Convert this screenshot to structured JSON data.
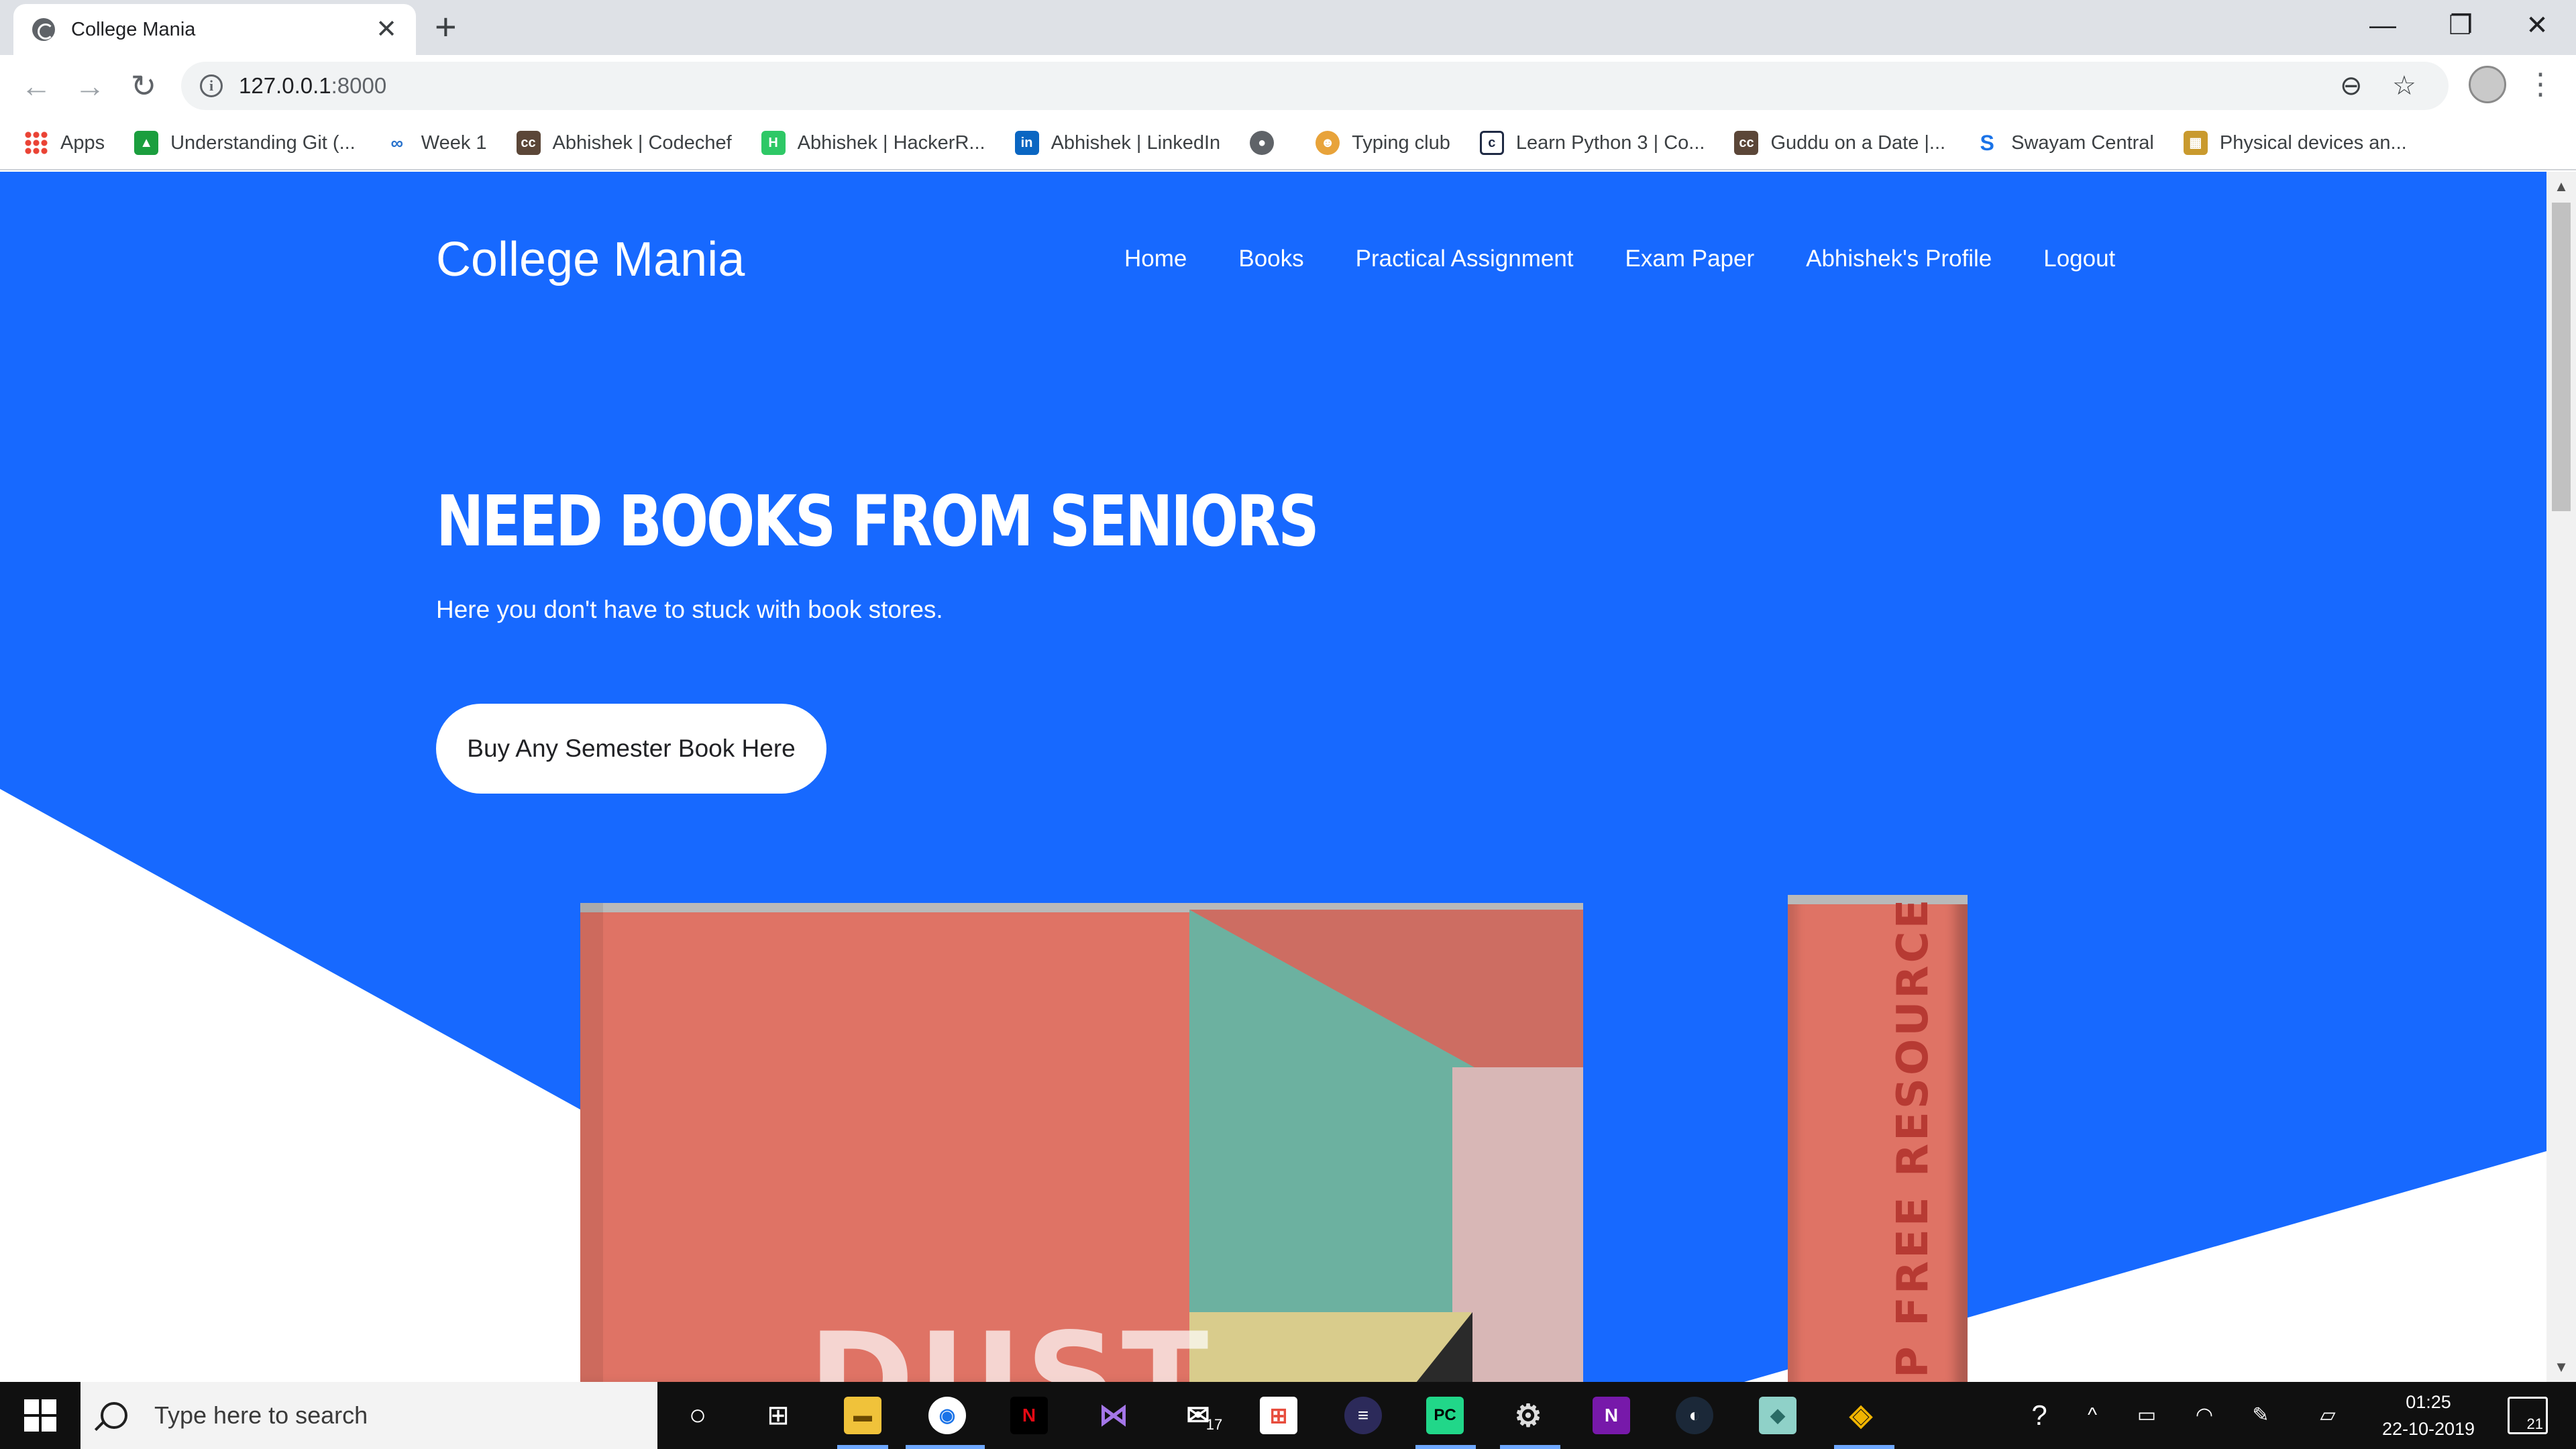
{
  "browser": {
    "tab_title": "College Mania",
    "new_tab_symbol": "+",
    "close_symbol": "✕",
    "url_host": "127.0.0.1",
    "url_port": ":8000",
    "window_buttons": {
      "minimize": "—",
      "restore": "❐",
      "close": "✕"
    }
  },
  "bookmarks": [
    {
      "label": "Apps",
      "icon": "apps-icon",
      "color": "#ea4335"
    },
    {
      "label": "Understanding Git (...",
      "icon": "git-icon",
      "color": "#1b9e3e"
    },
    {
      "label": "Week 1",
      "icon": "coursera-icon",
      "color": "#2a73cc"
    },
    {
      "label": "Abhishek | Codechef",
      "icon": "codechef-icon",
      "color": "#5b4638"
    },
    {
      "label": "Abhishek | HackerR...",
      "icon": "hackerrank-icon",
      "color": "#2ec866"
    },
    {
      "label": "Abhishek | LinkedIn",
      "icon": "linkedin-icon",
      "color": "#0a66c2"
    },
    {
      "label": "",
      "icon": "globe-icon",
      "color": "#5f6368"
    },
    {
      "label": "Typing club",
      "icon": "typingclub-icon",
      "color": "#e8a33a"
    },
    {
      "label": "Learn Python 3 | Co...",
      "icon": "codecademy-icon",
      "color": "#1f2a44"
    },
    {
      "label": "Guddu on a Date |...",
      "icon": "codechef-icon",
      "color": "#5b4638"
    },
    {
      "label": "Swayam Central",
      "icon": "swayam-icon",
      "color": "#1a73e8"
    },
    {
      "label": "Physical devices an...",
      "icon": "map-icon",
      "color": "#c99a2e"
    }
  ],
  "site": {
    "brand": "College Mania",
    "nav": [
      "Home",
      "Books",
      "Practical Assignment",
      "Exam Paper",
      "Abhishek's Profile",
      "Logout"
    ],
    "hero_title": "NEED BOOKS FROM SENIORS",
    "hero_subtitle": "Here you don't have to stuck with book stores.",
    "hero_button": "Buy Any Semester Book Here",
    "book_cover_text": "DUST",
    "book_spine_text": "P FREE RESOURCE",
    "colors": {
      "hero_bg": "#1769ff",
      "book": "#df7365"
    }
  },
  "taskbar": {
    "search_placeholder": "Type here to search",
    "mail_badge": "17",
    "time": "01:25",
    "date": "22-10-2019",
    "notification_count": "21"
  }
}
